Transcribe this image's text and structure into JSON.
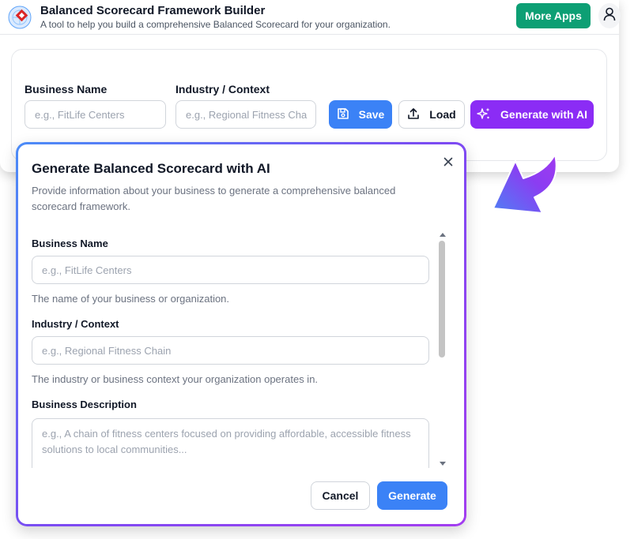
{
  "header": {
    "title": "Balanced Scorecard Framework Builder",
    "subtitle": "A tool to help you build a comprehensive Balanced Scorecard for your organization.",
    "more_apps_label": "More Apps",
    "logo_icon": "scorecard-logo-icon",
    "user_icon": "user-icon"
  },
  "form": {
    "business_name_label": "Business Name",
    "business_name_placeholder": "e.g., FitLife Centers",
    "industry_label": "Industry / Context",
    "industry_placeholder": "e.g., Regional Fitness Cha",
    "save_label": "Save",
    "load_label": "Load",
    "generate_ai_label": "Generate with AI"
  },
  "modal": {
    "title": "Generate Balanced Scorecard with AI",
    "description": "Provide information about your business to generate a comprehensive balanced scorecard framework.",
    "fields": [
      {
        "label": "Business Name",
        "placeholder": "e.g., FitLife Centers",
        "help": "The name of your business or organization."
      },
      {
        "label": "Industry / Context",
        "placeholder": "e.g., Regional Fitness Chain",
        "help": "The industry or business context your organization operates in."
      },
      {
        "label": "Business Description",
        "placeholder": "e.g., A chain of fitness centers focused on providing affordable, accessible fitness solutions to local communities..."
      }
    ],
    "cancel_label": "Cancel",
    "generate_label": "Generate"
  },
  "colors": {
    "primary": "#3b82f6",
    "accent_purple": "#8b2cf5",
    "more_apps_green": "#0d9f74"
  }
}
